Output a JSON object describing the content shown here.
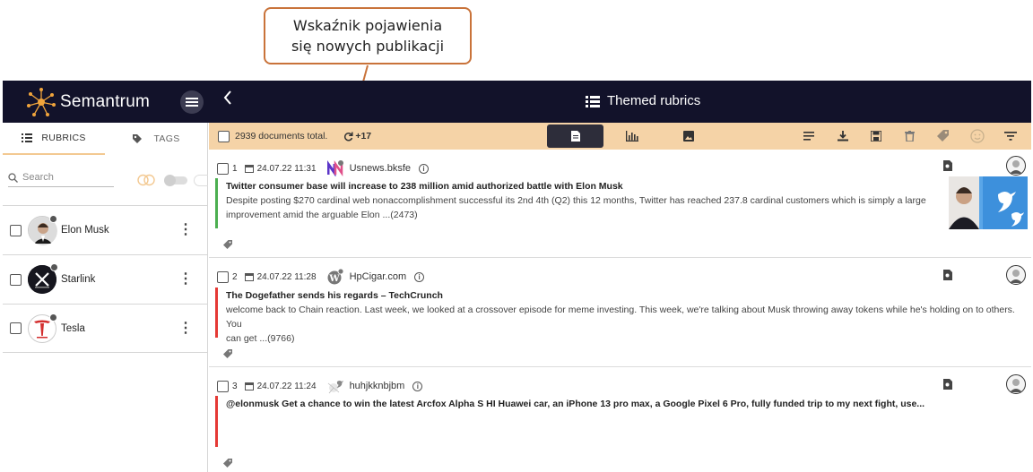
{
  "callout": {
    "line1": "Wskaźnik pojawienia",
    "line2": "się nowych publikacji"
  },
  "header": {
    "app_name": "Semantrum",
    "title": "Themed rubrics"
  },
  "sidebar": {
    "tabs": [
      {
        "label": "RUBRICS"
      },
      {
        "label": "TAGS"
      }
    ],
    "search_placeholder": "Search",
    "rubrics": [
      {
        "label": "Elon Musk",
        "icon": "elon-musk-avatar"
      },
      {
        "label": "Starlink",
        "icon": "starlink-logo"
      },
      {
        "label": "Tesla",
        "icon": "tesla-logo"
      }
    ]
  },
  "toolbar": {
    "total": "2939 documents total.",
    "new_count": "+17"
  },
  "documents": [
    {
      "num": "1",
      "date": "24.07.22 11:31",
      "source": "Usnews.bksfe",
      "title": "Twitter consumer base will increase to 238 million amid authorized battle with Elon Musk",
      "snippet_line1": "Despite posting $270 cardinal web nonaccomplishment successful its 2nd 4th (Q2) this 12 months, Twitter has reached 237.8 cardinal customers which is simply a large",
      "snippet_line2": "improvement amid the arguable Elon ...(2473)",
      "sentiment_color": "#4caf50"
    },
    {
      "num": "2",
      "date": "24.07.22 11:28",
      "source": "HpCigar.com",
      "title": "The Dogefather sends his regards – TechCrunch",
      "snippet_line1": "welcome back to Chain reaction. Last week, we looked at a crossover episode for meme investing. This week, we're talking about Musk throwing away tokens while he's holding on to others. You",
      "snippet_line2": "can get ...(9766)",
      "sentiment_color": "#e53935"
    },
    {
      "num": "3",
      "date": "24.07.22 11:24",
      "source": "huhjkknbjbm",
      "title": "@elonmusk Get a chance to win the latest Arcfox Alpha S HI Huawei car, an iPhone 13 pro max, a Google Pixel 6 Pro, fully funded trip to my next fight, use...",
      "sentiment_color": "#e53935"
    }
  ],
  "colors": {
    "topbar": "#12122a",
    "toolbar": "#f5d3a7",
    "accent": "#c9733a"
  }
}
